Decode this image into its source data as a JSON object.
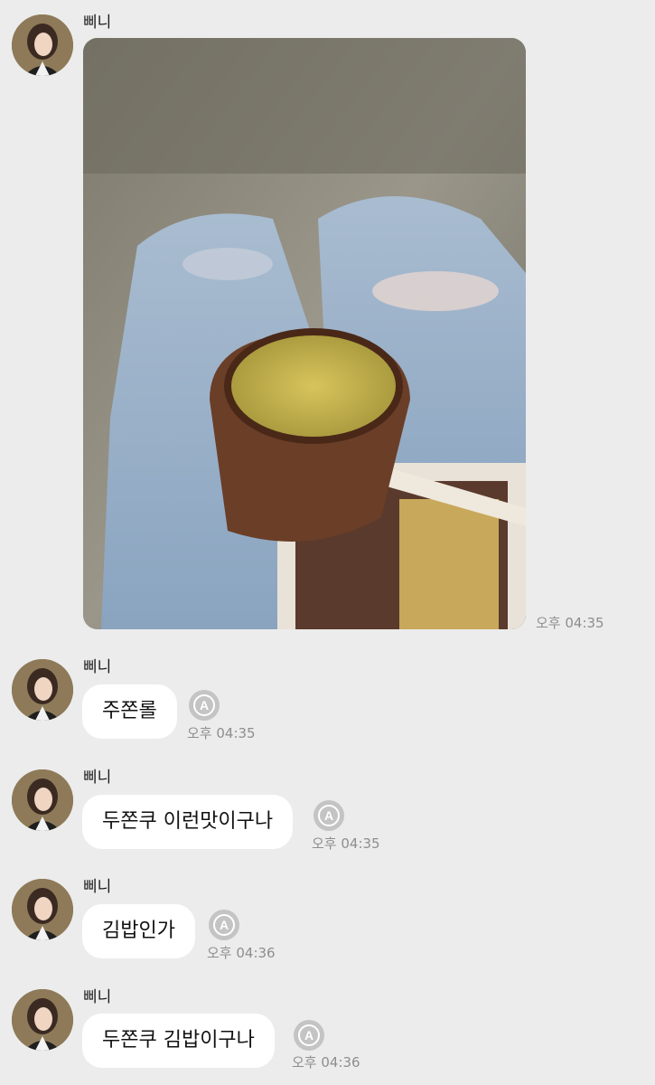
{
  "messages": [
    {
      "sender": "삐니",
      "type": "image",
      "time": "오후 04:35"
    },
    {
      "sender": "삐니",
      "type": "text",
      "text": "주쫀롤",
      "time": "오후 04:35"
    },
    {
      "sender": "삐니",
      "type": "text",
      "text": "두쫀쿠 이런맛이구나",
      "time": "오후 04:35"
    },
    {
      "sender": "삐니",
      "type": "text",
      "text": "김밥인가",
      "time": "오후 04:36"
    },
    {
      "sender": "삐니",
      "type": "text",
      "text": "두쫀쿠 김밥이구나",
      "time": "오후 04:36"
    }
  ],
  "icons": {
    "translate": "translate-icon",
    "avatar": "avatar"
  },
  "colors": {
    "background": "#ececec",
    "bubble": "#ffffff",
    "time": "#8e8e8e",
    "icon": "#c4c4c4"
  }
}
